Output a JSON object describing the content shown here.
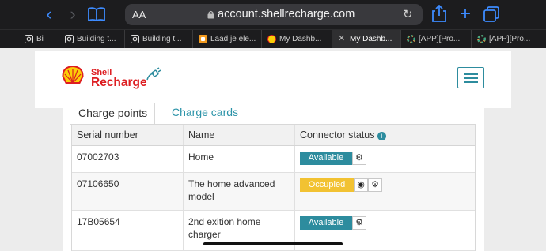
{
  "browser": {
    "font_size_button": "AA",
    "url": "account.shellrecharge.com",
    "tabs": [
      {
        "title": "Bi",
        "favicon": "o-square-icon",
        "active": false
      },
      {
        "title": "Building t...",
        "favicon": "o-square-icon",
        "active": false
      },
      {
        "title": "Building t...",
        "favicon": "o-square-icon",
        "active": false
      },
      {
        "title": "Laad je ele...",
        "favicon": "orange-app-icon",
        "active": false
      },
      {
        "title": "My Dashb...",
        "favicon": "shell-icon",
        "active": false
      },
      {
        "title": "My Dashb...",
        "favicon": "close-icon",
        "active": true
      },
      {
        "title": "[APP][Pro...",
        "favicon": "color-wheel-icon",
        "active": false
      },
      {
        "title": "[APP][Pro...",
        "favicon": "color-wheel-icon",
        "active": false
      }
    ]
  },
  "header": {
    "logo_line1": "Shell",
    "logo_line2": "Recharge"
  },
  "panel_tabs": {
    "charge_points": "Charge points",
    "charge_cards": "Charge cards"
  },
  "table": {
    "columns": [
      "Serial number",
      "Name",
      "Connector status"
    ],
    "info_glyph": "i",
    "rows": [
      {
        "serial": "07002703",
        "name": "Home",
        "status": "Available"
      },
      {
        "serial": "07106650",
        "name": "The home advanced model",
        "status": "Occupied"
      },
      {
        "serial": "17B05654",
        "name": "2nd exition home charger",
        "status": "Available"
      }
    ]
  },
  "colors": {
    "accent": "#2d8c9e",
    "available": "#2d8c9e",
    "occupied": "#f2c232",
    "shell_red": "#dd1d21",
    "shell_yellow": "#fbce07",
    "safari_blue": "#3d8bff"
  }
}
